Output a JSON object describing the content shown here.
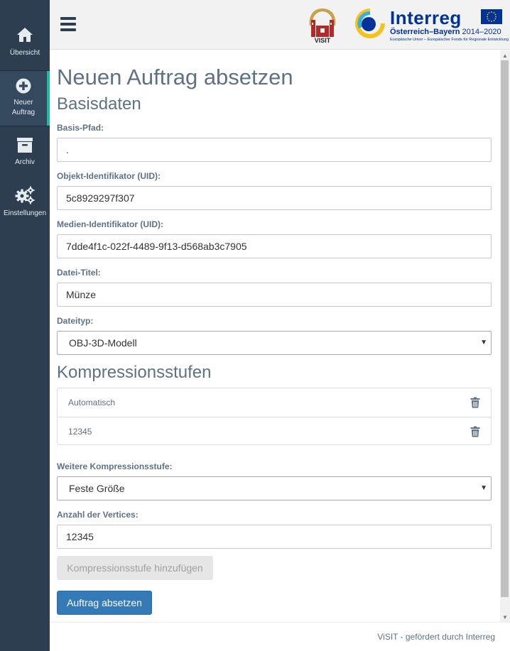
{
  "sidebar": {
    "items": [
      {
        "label": "Übersicht",
        "icon": "home-icon"
      },
      {
        "label_line1": "Neuer",
        "label_line2": "Auftrag",
        "icon": "plus-circle-icon",
        "active": true
      },
      {
        "label": "Archiv",
        "icon": "archive-icon"
      },
      {
        "label": "Einstellungen",
        "icon": "gears-icon"
      }
    ]
  },
  "header": {
    "logo_visit": "VISIT",
    "interreg_title": "Interreg",
    "interreg_region": "Österreich–Bayern",
    "interreg_years": "2014–2020",
    "interreg_fund": "Europäische Union – Europäischer Fonds für Regionale Entwicklung"
  },
  "page": {
    "title": "Neuen Auftrag absetzen",
    "section_basis": "Basisdaten",
    "section_compression": "Kompressionsstufen"
  },
  "form": {
    "basis_pfad_label": "Basis-Pfad:",
    "basis_pfad_value": ".",
    "objekt_uid_label": "Objekt-Identifikator (UID):",
    "objekt_uid_value": "5c8929297f307",
    "medien_uid_label": "Medien-Identifikator (UID):",
    "medien_uid_value": "7dde4f1c-022f-4489-9f13-d568ab3c7905",
    "datei_titel_label": "Datei-Titel:",
    "datei_titel_value": "Münze",
    "dateityp_label": "Dateityp:",
    "dateityp_value": "OBJ-3D-Modell",
    "compression_levels": [
      {
        "label": "Automatisch"
      },
      {
        "label": "12345"
      }
    ],
    "weitere_label": "Weitere Kompressionsstufe:",
    "weitere_value": "Feste Größe",
    "vertices_label": "Anzahl der Vertices:",
    "vertices_value": "12345",
    "add_button": "Kompressionsstufe hinzufügen",
    "submit_button": "Auftrag absetzen"
  },
  "footer": {
    "text": "ViSIT - gefördert durch Interreg"
  },
  "colors": {
    "sidebar_bg": "#2c3e50",
    "active_accent": "#1abc9c",
    "heading": "#5f7186",
    "primary": "#337ab7"
  }
}
